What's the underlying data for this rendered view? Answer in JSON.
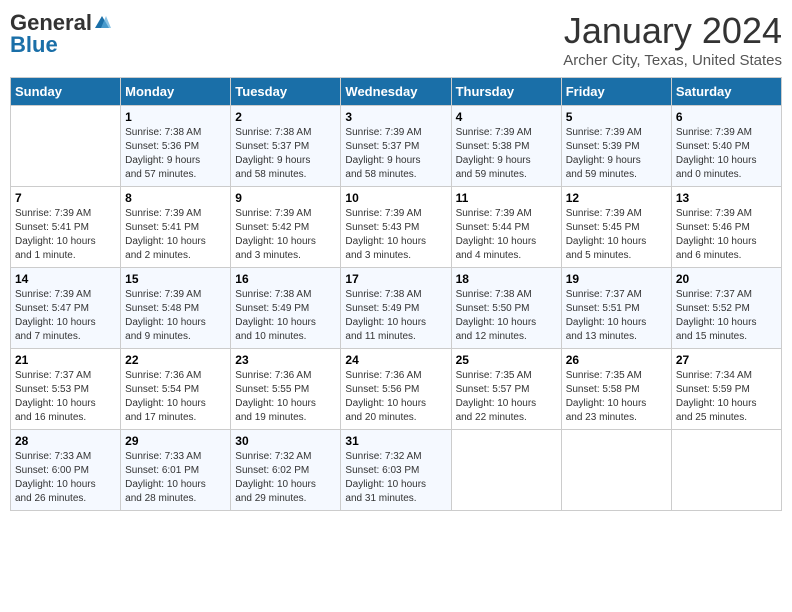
{
  "header": {
    "logo_general": "General",
    "logo_blue": "Blue",
    "month": "January 2024",
    "location": "Archer City, Texas, United States"
  },
  "days_of_week": [
    "Sunday",
    "Monday",
    "Tuesday",
    "Wednesday",
    "Thursday",
    "Friday",
    "Saturday"
  ],
  "weeks": [
    [
      {
        "num": "",
        "info": ""
      },
      {
        "num": "1",
        "info": "Sunrise: 7:38 AM\nSunset: 5:36 PM\nDaylight: 9 hours\nand 57 minutes."
      },
      {
        "num": "2",
        "info": "Sunrise: 7:38 AM\nSunset: 5:37 PM\nDaylight: 9 hours\nand 58 minutes."
      },
      {
        "num": "3",
        "info": "Sunrise: 7:39 AM\nSunset: 5:37 PM\nDaylight: 9 hours\nand 58 minutes."
      },
      {
        "num": "4",
        "info": "Sunrise: 7:39 AM\nSunset: 5:38 PM\nDaylight: 9 hours\nand 59 minutes."
      },
      {
        "num": "5",
        "info": "Sunrise: 7:39 AM\nSunset: 5:39 PM\nDaylight: 9 hours\nand 59 minutes."
      },
      {
        "num": "6",
        "info": "Sunrise: 7:39 AM\nSunset: 5:40 PM\nDaylight: 10 hours\nand 0 minutes."
      }
    ],
    [
      {
        "num": "7",
        "info": "Sunrise: 7:39 AM\nSunset: 5:41 PM\nDaylight: 10 hours\nand 1 minute."
      },
      {
        "num": "8",
        "info": "Sunrise: 7:39 AM\nSunset: 5:41 PM\nDaylight: 10 hours\nand 2 minutes."
      },
      {
        "num": "9",
        "info": "Sunrise: 7:39 AM\nSunset: 5:42 PM\nDaylight: 10 hours\nand 3 minutes."
      },
      {
        "num": "10",
        "info": "Sunrise: 7:39 AM\nSunset: 5:43 PM\nDaylight: 10 hours\nand 3 minutes."
      },
      {
        "num": "11",
        "info": "Sunrise: 7:39 AM\nSunset: 5:44 PM\nDaylight: 10 hours\nand 4 minutes."
      },
      {
        "num": "12",
        "info": "Sunrise: 7:39 AM\nSunset: 5:45 PM\nDaylight: 10 hours\nand 5 minutes."
      },
      {
        "num": "13",
        "info": "Sunrise: 7:39 AM\nSunset: 5:46 PM\nDaylight: 10 hours\nand 6 minutes."
      }
    ],
    [
      {
        "num": "14",
        "info": "Sunrise: 7:39 AM\nSunset: 5:47 PM\nDaylight: 10 hours\nand 7 minutes."
      },
      {
        "num": "15",
        "info": "Sunrise: 7:39 AM\nSunset: 5:48 PM\nDaylight: 10 hours\nand 9 minutes."
      },
      {
        "num": "16",
        "info": "Sunrise: 7:38 AM\nSunset: 5:49 PM\nDaylight: 10 hours\nand 10 minutes."
      },
      {
        "num": "17",
        "info": "Sunrise: 7:38 AM\nSunset: 5:49 PM\nDaylight: 10 hours\nand 11 minutes."
      },
      {
        "num": "18",
        "info": "Sunrise: 7:38 AM\nSunset: 5:50 PM\nDaylight: 10 hours\nand 12 minutes."
      },
      {
        "num": "19",
        "info": "Sunrise: 7:37 AM\nSunset: 5:51 PM\nDaylight: 10 hours\nand 13 minutes."
      },
      {
        "num": "20",
        "info": "Sunrise: 7:37 AM\nSunset: 5:52 PM\nDaylight: 10 hours\nand 15 minutes."
      }
    ],
    [
      {
        "num": "21",
        "info": "Sunrise: 7:37 AM\nSunset: 5:53 PM\nDaylight: 10 hours\nand 16 minutes."
      },
      {
        "num": "22",
        "info": "Sunrise: 7:36 AM\nSunset: 5:54 PM\nDaylight: 10 hours\nand 17 minutes."
      },
      {
        "num": "23",
        "info": "Sunrise: 7:36 AM\nSunset: 5:55 PM\nDaylight: 10 hours\nand 19 minutes."
      },
      {
        "num": "24",
        "info": "Sunrise: 7:36 AM\nSunset: 5:56 PM\nDaylight: 10 hours\nand 20 minutes."
      },
      {
        "num": "25",
        "info": "Sunrise: 7:35 AM\nSunset: 5:57 PM\nDaylight: 10 hours\nand 22 minutes."
      },
      {
        "num": "26",
        "info": "Sunrise: 7:35 AM\nSunset: 5:58 PM\nDaylight: 10 hours\nand 23 minutes."
      },
      {
        "num": "27",
        "info": "Sunrise: 7:34 AM\nSunset: 5:59 PM\nDaylight: 10 hours\nand 25 minutes."
      }
    ],
    [
      {
        "num": "28",
        "info": "Sunrise: 7:33 AM\nSunset: 6:00 PM\nDaylight: 10 hours\nand 26 minutes."
      },
      {
        "num": "29",
        "info": "Sunrise: 7:33 AM\nSunset: 6:01 PM\nDaylight: 10 hours\nand 28 minutes."
      },
      {
        "num": "30",
        "info": "Sunrise: 7:32 AM\nSunset: 6:02 PM\nDaylight: 10 hours\nand 29 minutes."
      },
      {
        "num": "31",
        "info": "Sunrise: 7:32 AM\nSunset: 6:03 PM\nDaylight: 10 hours\nand 31 minutes."
      },
      {
        "num": "",
        "info": ""
      },
      {
        "num": "",
        "info": ""
      },
      {
        "num": "",
        "info": ""
      }
    ]
  ]
}
